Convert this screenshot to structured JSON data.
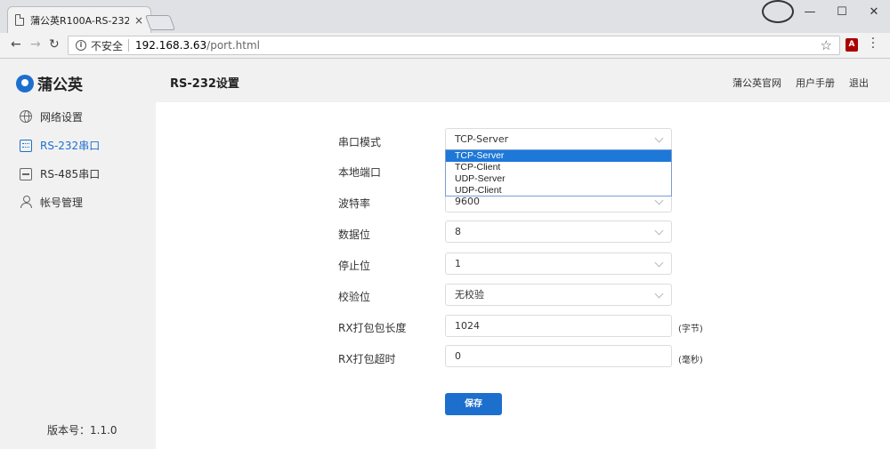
{
  "browser": {
    "tab_title": "蒲公英R100A-RS-232设",
    "tab_close": "×",
    "url_security": "不安全",
    "url_host": "192.168.3.63",
    "url_path": "/port.html",
    "minimize": "—",
    "maximize": "☐",
    "close": "✕"
  },
  "sidebar": {
    "logo_text": "蒲公英",
    "items": [
      {
        "label": "网络设置",
        "icon": "globe-icon",
        "active": false
      },
      {
        "label": "RS-232串口",
        "icon": "serial-port-icon",
        "active": true
      },
      {
        "label": "RS-485串口",
        "icon": "serial-port-icon",
        "active": false
      },
      {
        "label": "帐号管理",
        "icon": "user-icon",
        "active": false
      }
    ],
    "version": "版本号：1.1.0"
  },
  "header": {
    "title": "RS-232设置",
    "links": [
      "蒲公英官网",
      "用户手册",
      "退出"
    ]
  },
  "form": {
    "mode": {
      "label": "串口模式",
      "value": "TCP-Server"
    },
    "local_port": {
      "label": "本地端口"
    },
    "baud": {
      "label": "波特率",
      "value": "9600"
    },
    "data_bits": {
      "label": "数据位",
      "value": "8"
    },
    "stop_bits": {
      "label": "停止位",
      "value": "1"
    },
    "parity": {
      "label": "校验位",
      "value": "无校验"
    },
    "rx_pack_len": {
      "label": "RX打包包长度",
      "value": "1024",
      "unit": "(字节)"
    },
    "rx_pack_timeout": {
      "label": "RX打包超时",
      "value": "0",
      "unit": "(毫秒)"
    },
    "mode_options": [
      "TCP-Server",
      "TCP-Client",
      "UDP-Server",
      "UDP-Client"
    ],
    "save_label": "保存"
  },
  "colors": {
    "accent": "#1d6fce",
    "dropdown_highlight": "#1e78d7"
  }
}
